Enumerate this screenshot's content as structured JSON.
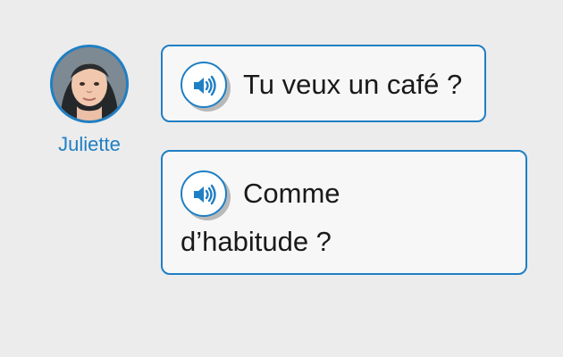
{
  "speaker": {
    "name": "Juliette"
  },
  "messages": [
    {
      "text": "Tu veux un café ?"
    },
    {
      "text_line_1": "Comme",
      "text_line_2": "d’habitude ?"
    }
  ],
  "colors": {
    "accent": "#1f7fc4",
    "background": "#ececec",
    "bubble": "#f7f7f7",
    "text": "#1a1a1a"
  },
  "icons": {
    "sound": "speaker-icon"
  }
}
